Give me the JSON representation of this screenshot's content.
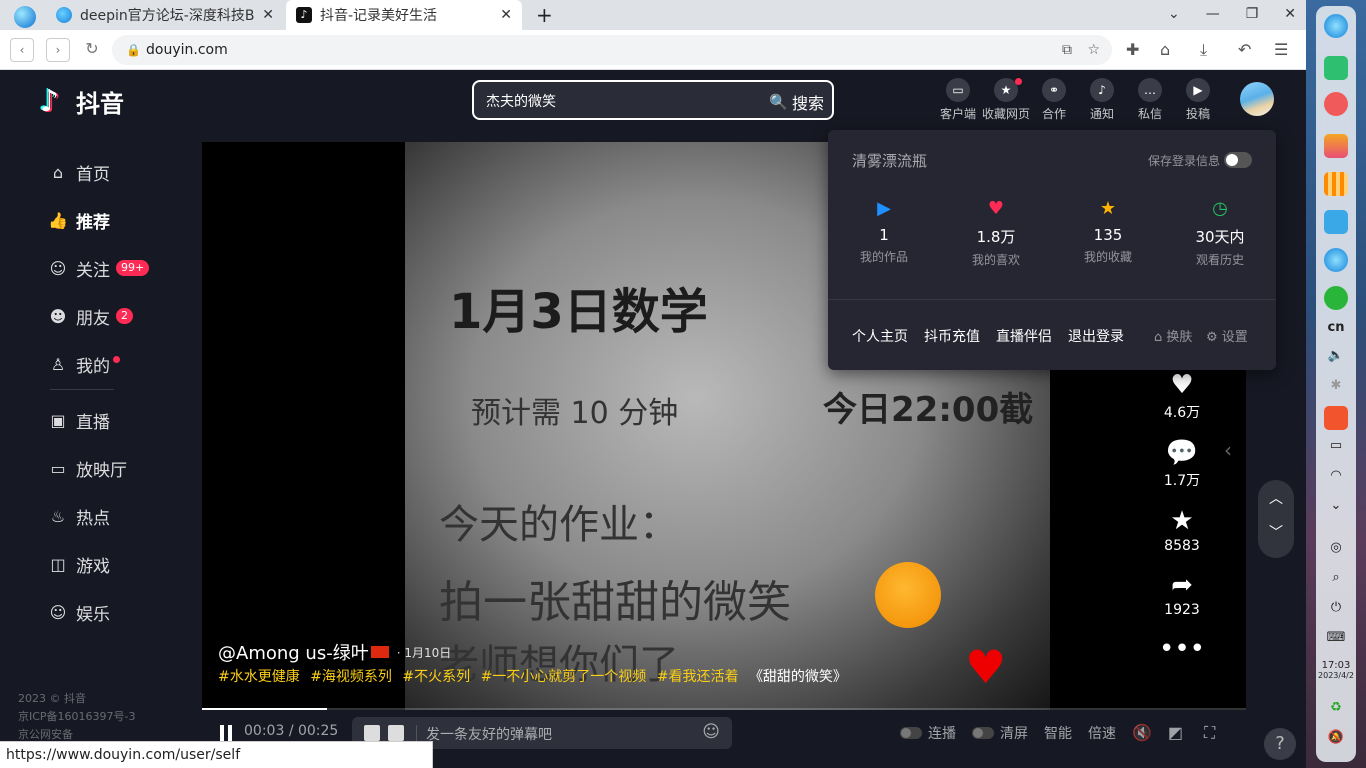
{
  "browser": {
    "tabs": [
      {
        "title": "deepin官方论坛-深度科技B",
        "active": false
      },
      {
        "title": "抖音-记录美好生活",
        "active": true
      }
    ],
    "url": "douyin.com",
    "status_url": "https://www.douyin.com/user/self"
  },
  "douyin": {
    "brand": "抖音",
    "search": {
      "value": "杰夫的微笑",
      "button": "搜索"
    },
    "top_icons": [
      "客户端",
      "收藏网页",
      "合作",
      "通知",
      "私信",
      "投稿"
    ],
    "nav": [
      {
        "label": "首页",
        "icon": "home-icon"
      },
      {
        "label": "推荐",
        "icon": "thumbs-up-icon"
      },
      {
        "label": "关注",
        "icon": "follow-icon",
        "badge": "99+"
      },
      {
        "label": "朋友",
        "icon": "friends-icon",
        "badge": "2"
      },
      {
        "label": "我的",
        "icon": "user-icon"
      }
    ],
    "nav2": [
      {
        "label": "直播",
        "icon": "live-icon"
      },
      {
        "label": "放映厅",
        "icon": "tv-icon"
      },
      {
        "label": "热点",
        "icon": "fire-icon"
      },
      {
        "label": "游戏",
        "icon": "gamepad-icon"
      },
      {
        "label": "娱乐",
        "icon": "smile-icon"
      }
    ],
    "footer": [
      "2023 © 抖音",
      "京ICP备16016397号-3",
      "京公网安备"
    ],
    "video": {
      "poster_lines": [
        "1月3日数学",
        "预计需 10 分钟",
        "今日22:00截",
        "今天的作业：",
        "拍一张甜甜的微笑",
        "老师想你们了"
      ],
      "author": "@Among us-绿叶",
      "date": "· 1月10日",
      "tags": [
        "#水水更健康",
        "#海视频系列",
        "#不火系列",
        "#一不小心就剪了一个视频",
        "#看我还活着"
      ],
      "music": "《甜甜的微笑》",
      "progress": 0.12,
      "actions": {
        "likes": "4.6万",
        "comments": "1.7万",
        "favorites": "8583",
        "shares": "1923"
      }
    },
    "controls": {
      "current": "00:03",
      "sep": "/",
      "total": "00:25",
      "danmu_placeholder": "发一条友好的弹幕吧",
      "right": [
        "连播",
        "清屏",
        "智能",
        "倍速"
      ]
    },
    "panel": {
      "username": "清雾漂流瓶",
      "save_login": "保存登录信息",
      "stats": [
        {
          "value": "1",
          "label": "我的作品",
          "color": "#1e90ff"
        },
        {
          "value": "1.8万",
          "label": "我的喜欢",
          "color": "#fe2c55"
        },
        {
          "value": "135",
          "label": "我的收藏",
          "color": "#ffb400"
        },
        {
          "value": "30天内",
          "label": "观看历史",
          "color": "#22c35e"
        }
      ],
      "links": [
        "个人主页",
        "抖币充值",
        "直播伴侣",
        "退出登录"
      ],
      "skin": "换肤",
      "settings": "设置"
    },
    "dock_time": {
      "time": "17:03",
      "date": "2023/4/2"
    }
  }
}
